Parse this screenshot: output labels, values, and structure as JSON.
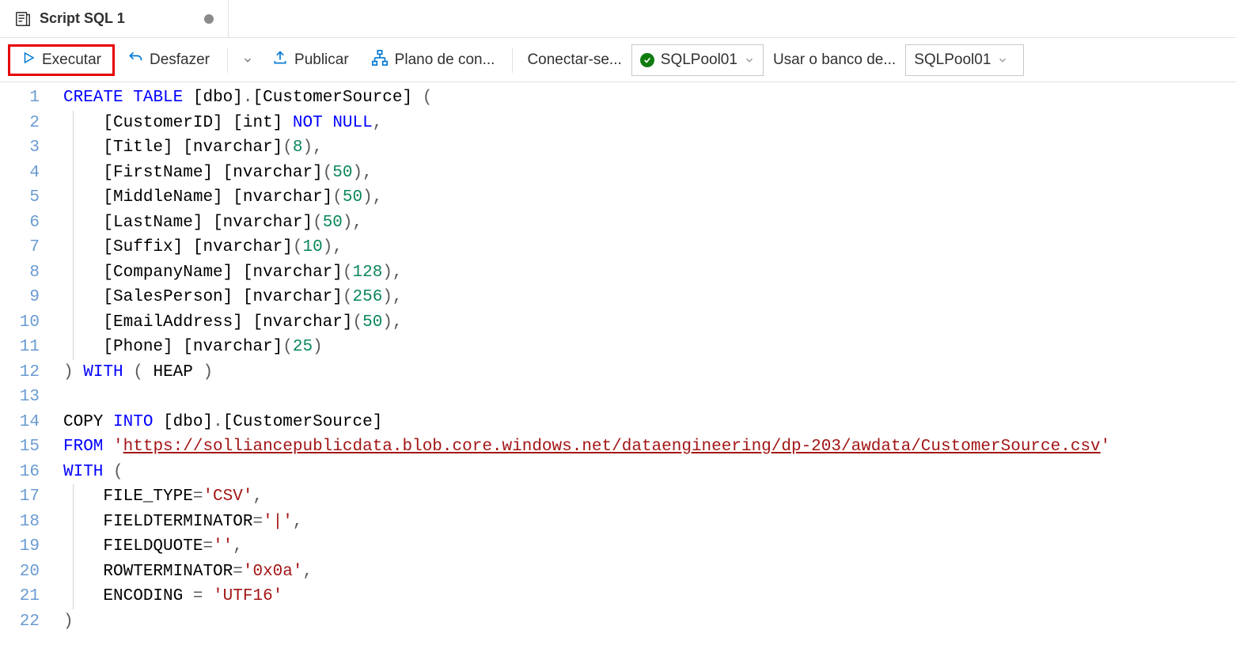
{
  "tab": {
    "title": "Script SQL 1",
    "dirty": true
  },
  "toolbar": {
    "run": "Executar",
    "undo": "Desfazer",
    "publish": "Publicar",
    "plan": "Plano de con...",
    "connect_label": "Conectar-se...",
    "connect_value": "SQLPool01",
    "db_label": "Usar o banco de...",
    "db_value": "SQLPool01"
  },
  "code": {
    "url": "https://solliancepublicdata.blob.core.windows.net/dataengineering/dp-203/awdata/CustomerSource.csv",
    "lines": [
      {
        "n": 1,
        "indent": 0,
        "tokens": [
          [
            "kw",
            "CREATE"
          ],
          [
            "sp",
            " "
          ],
          [
            "kw",
            "TABLE"
          ],
          [
            "sp",
            " "
          ],
          [
            "id",
            "[dbo]"
          ],
          [
            "op",
            "."
          ],
          [
            "id",
            "[CustomerSource]"
          ],
          [
            "sp",
            " "
          ],
          [
            "op",
            "("
          ]
        ]
      },
      {
        "n": 2,
        "indent": 1,
        "guide": true,
        "tokens": [
          [
            "id",
            "[CustomerID]"
          ],
          [
            "sp",
            " "
          ],
          [
            "id",
            "[int]"
          ],
          [
            "sp",
            " "
          ],
          [
            "kw",
            "NOT"
          ],
          [
            "sp",
            " "
          ],
          [
            "kw",
            "NULL"
          ],
          [
            "op",
            ","
          ]
        ]
      },
      {
        "n": 3,
        "indent": 1,
        "guide": true,
        "tokens": [
          [
            "id",
            "[Title]"
          ],
          [
            "sp",
            " "
          ],
          [
            "id",
            "[nvarchar]"
          ],
          [
            "op",
            "("
          ],
          [
            "num",
            "8"
          ],
          [
            "op",
            ")"
          ],
          [
            "op",
            ","
          ]
        ]
      },
      {
        "n": 4,
        "indent": 1,
        "guide": true,
        "tokens": [
          [
            "id",
            "[FirstName]"
          ],
          [
            "sp",
            " "
          ],
          [
            "id",
            "[nvarchar]"
          ],
          [
            "op",
            "("
          ],
          [
            "num",
            "50"
          ],
          [
            "op",
            ")"
          ],
          [
            "op",
            ","
          ]
        ]
      },
      {
        "n": 5,
        "indent": 1,
        "guide": true,
        "tokens": [
          [
            "id",
            "[MiddleName]"
          ],
          [
            "sp",
            " "
          ],
          [
            "id",
            "[nvarchar]"
          ],
          [
            "op",
            "("
          ],
          [
            "num",
            "50"
          ],
          [
            "op",
            ")"
          ],
          [
            "op",
            ","
          ]
        ]
      },
      {
        "n": 6,
        "indent": 1,
        "guide": true,
        "tokens": [
          [
            "id",
            "[LastName]"
          ],
          [
            "sp",
            " "
          ],
          [
            "id",
            "[nvarchar]"
          ],
          [
            "op",
            "("
          ],
          [
            "num",
            "50"
          ],
          [
            "op",
            ")"
          ],
          [
            "op",
            ","
          ]
        ]
      },
      {
        "n": 7,
        "indent": 1,
        "guide": true,
        "tokens": [
          [
            "id",
            "[Suffix]"
          ],
          [
            "sp",
            " "
          ],
          [
            "id",
            "[nvarchar]"
          ],
          [
            "op",
            "("
          ],
          [
            "num",
            "10"
          ],
          [
            "op",
            ")"
          ],
          [
            "op",
            ","
          ]
        ]
      },
      {
        "n": 8,
        "indent": 1,
        "guide": true,
        "tokens": [
          [
            "id",
            "[CompanyName]"
          ],
          [
            "sp",
            " "
          ],
          [
            "id",
            "[nvarchar]"
          ],
          [
            "op",
            "("
          ],
          [
            "num",
            "128"
          ],
          [
            "op",
            ")"
          ],
          [
            "op",
            ","
          ]
        ]
      },
      {
        "n": 9,
        "indent": 1,
        "guide": true,
        "tokens": [
          [
            "id",
            "[SalesPerson]"
          ],
          [
            "sp",
            " "
          ],
          [
            "id",
            "[nvarchar]"
          ],
          [
            "op",
            "("
          ],
          [
            "num",
            "256"
          ],
          [
            "op",
            ")"
          ],
          [
            "op",
            ","
          ]
        ]
      },
      {
        "n": 10,
        "indent": 1,
        "guide": true,
        "tokens": [
          [
            "id",
            "[EmailAddress]"
          ],
          [
            "sp",
            " "
          ],
          [
            "id",
            "[nvarchar]"
          ],
          [
            "op",
            "("
          ],
          [
            "num",
            "50"
          ],
          [
            "op",
            ")"
          ],
          [
            "op",
            ","
          ]
        ]
      },
      {
        "n": 11,
        "indent": 1,
        "guide": true,
        "tokens": [
          [
            "id",
            "[Phone]"
          ],
          [
            "sp",
            " "
          ],
          [
            "id",
            "[nvarchar]"
          ],
          [
            "op",
            "("
          ],
          [
            "num",
            "25"
          ],
          [
            "op",
            ")"
          ]
        ]
      },
      {
        "n": 12,
        "indent": 0,
        "tokens": [
          [
            "op",
            ")"
          ],
          [
            "sp",
            " "
          ],
          [
            "kw",
            "WITH"
          ],
          [
            "sp",
            " "
          ],
          [
            "op",
            "("
          ],
          [
            "sp",
            " "
          ],
          [
            "id",
            "HEAP"
          ],
          [
            "sp",
            " "
          ],
          [
            "op",
            ")"
          ]
        ]
      },
      {
        "n": 13,
        "indent": 0,
        "tokens": []
      },
      {
        "n": 14,
        "indent": 0,
        "tokens": [
          [
            "id",
            "COPY"
          ],
          [
            "sp",
            " "
          ],
          [
            "kw",
            "INTO"
          ],
          [
            "sp",
            " "
          ],
          [
            "id",
            "[dbo]"
          ],
          [
            "op",
            "."
          ],
          [
            "id",
            "[CustomerSource]"
          ]
        ]
      },
      {
        "n": 15,
        "indent": 0,
        "tokens": [
          [
            "kw",
            "FROM"
          ],
          [
            "sp",
            " "
          ],
          [
            "str",
            "'"
          ],
          [
            "url",
            "https://solliancepublicdata.blob.core.windows.net/dataengineering/dp-203/awdata/CustomerSource.csv"
          ],
          [
            "str",
            "'"
          ]
        ]
      },
      {
        "n": 16,
        "indent": 0,
        "tokens": [
          [
            "kw",
            "WITH"
          ],
          [
            "sp",
            " "
          ],
          [
            "op",
            "("
          ]
        ]
      },
      {
        "n": 17,
        "indent": 1,
        "guide": true,
        "tokens": [
          [
            "id",
            "FILE_TYPE"
          ],
          [
            "op",
            "="
          ],
          [
            "str",
            "'CSV'"
          ],
          [
            "op",
            ","
          ]
        ]
      },
      {
        "n": 18,
        "indent": 1,
        "guide": true,
        "tokens": [
          [
            "id",
            "FIELDTERMINATOR"
          ],
          [
            "op",
            "="
          ],
          [
            "str",
            "'|'"
          ],
          [
            "op",
            ","
          ]
        ]
      },
      {
        "n": 19,
        "indent": 1,
        "guide": true,
        "tokens": [
          [
            "id",
            "FIELDQUOTE"
          ],
          [
            "op",
            "="
          ],
          [
            "str",
            "''"
          ],
          [
            "op",
            ","
          ]
        ]
      },
      {
        "n": 20,
        "indent": 1,
        "guide": true,
        "tokens": [
          [
            "id",
            "ROWTERMINATOR"
          ],
          [
            "op",
            "="
          ],
          [
            "str",
            "'0x0a'"
          ],
          [
            "op",
            ","
          ]
        ]
      },
      {
        "n": 21,
        "indent": 1,
        "guide": true,
        "tokens": [
          [
            "id",
            "ENCODING"
          ],
          [
            "sp",
            " "
          ],
          [
            "op",
            "="
          ],
          [
            "sp",
            " "
          ],
          [
            "str",
            "'UTF16'"
          ]
        ]
      },
      {
        "n": 22,
        "indent": 0,
        "tokens": [
          [
            "op",
            ")"
          ]
        ]
      }
    ]
  }
}
